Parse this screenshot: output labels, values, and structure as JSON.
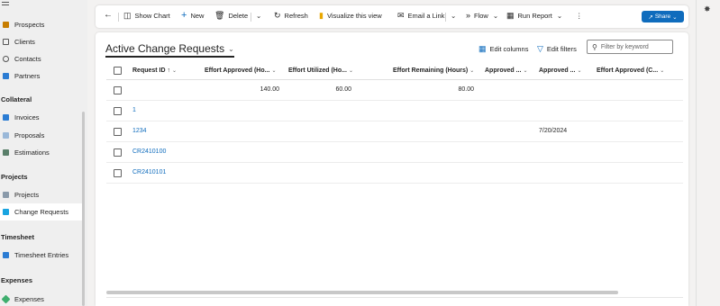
{
  "sidebar": {
    "top_items": [
      {
        "label": "Prospects",
        "icon": "prospects-icon",
        "color": "#c77d00"
      },
      {
        "label": "Clients",
        "icon": "clients-icon",
        "color": "#555555"
      },
      {
        "label": "Contacts",
        "icon": "contacts-icon",
        "color": "#555555"
      },
      {
        "label": "Partners",
        "icon": "partners-icon",
        "color": "#2b7cd3"
      }
    ],
    "groups": [
      {
        "title": "Collateral",
        "items": [
          {
            "label": "Invoices",
            "icon": "invoices-icon",
            "color": "#2b7cd3"
          },
          {
            "label": "Proposals",
            "icon": "proposals-icon",
            "color": "#9ab8d8"
          },
          {
            "label": "Estimations",
            "icon": "estimations-icon",
            "color": "#5a7f6a"
          }
        ]
      },
      {
        "title": "Projects",
        "items": [
          {
            "label": "Projects",
            "icon": "projects-icon",
            "color": "#8a9aaa"
          },
          {
            "label": "Change Requests",
            "icon": "change-requests-icon",
            "color": "#19a4e0",
            "active": true
          }
        ]
      },
      {
        "title": "Timesheet",
        "items": [
          {
            "label": "Timesheet Entries",
            "icon": "timesheet-entries-icon",
            "color": "#2b7cd3"
          }
        ]
      },
      {
        "title": "Expenses",
        "items": [
          {
            "label": "Expenses",
            "icon": "expenses-icon",
            "color": "#3fae6e"
          }
        ]
      }
    ]
  },
  "commandbar": {
    "back_icon": "arrow-left-icon",
    "show_chart": "Show Chart",
    "new": "New",
    "delete": "Delete",
    "refresh": "Refresh",
    "visualize": "Visualize this view",
    "email_link": "Email a Link",
    "flow": "Flow",
    "run_report": "Run Report",
    "share": "Share"
  },
  "view": {
    "title": "Active Change Requests",
    "edit_columns": "Edit columns",
    "edit_filters": "Edit filters",
    "filter_placeholder": "Filter by keyword"
  },
  "grid": {
    "columns": [
      "Request ID ↑",
      "Effort Approved (Ho...",
      "Effort Utilized (Ho...",
      "Effort Remaining (Hours)",
      "Approved ...",
      "Approved ...",
      "Effort Approved (C..."
    ],
    "rows": [
      {
        "request_id": "",
        "effort_approved": "140.00",
        "effort_utilized": "60.00",
        "effort_remaining": "80.00",
        "approved_date": ""
      },
      {
        "request_id": "1",
        "effort_approved": "",
        "effort_utilized": "",
        "effort_remaining": "",
        "approved_date": ""
      },
      {
        "request_id": "1234",
        "effort_approved": "",
        "effort_utilized": "",
        "effort_remaining": "",
        "approved_date": "7/20/2024"
      },
      {
        "request_id": "CR2410100",
        "effort_approved": "",
        "effort_utilized": "",
        "effort_remaining": "",
        "approved_date": ""
      },
      {
        "request_id": "CR2410101",
        "effort_approved": "",
        "effort_utilized": "",
        "effort_remaining": "",
        "approved_date": ""
      }
    ]
  },
  "colors": {
    "accent": "#0f6cbd",
    "link": "#0f6cbd"
  }
}
